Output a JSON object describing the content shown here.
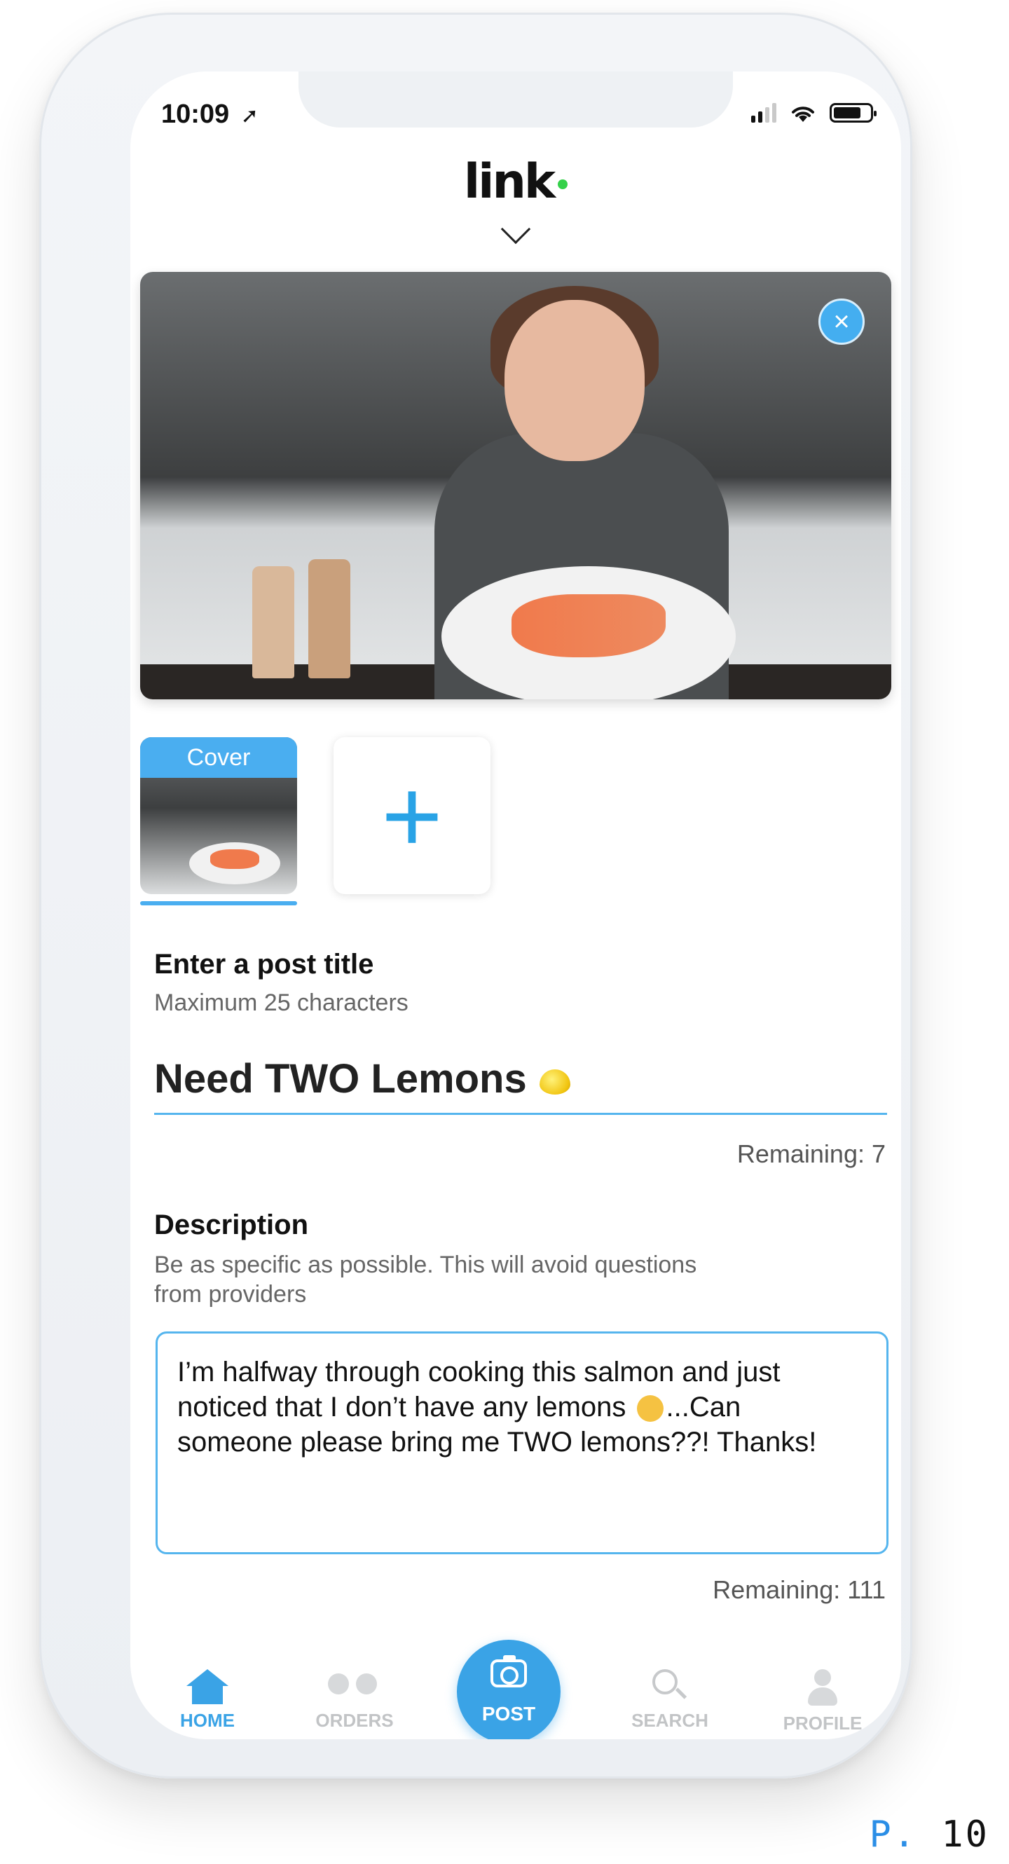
{
  "status_bar": {
    "time": "10:09"
  },
  "header": {
    "logo": "link"
  },
  "photos": {
    "cover_label": "Cover",
    "add_label": "+"
  },
  "title_section": {
    "label": "Enter a post title",
    "hint": "Maximum 25 characters",
    "value": "Need TWO Lemons",
    "remaining": "Remaining: 7"
  },
  "description_section": {
    "label": "Description",
    "hint_line1": "Be as specific as possible. This will avoid questions",
    "hint_line2": "from providers",
    "text_line1": "I’m halfway through cooking this salmon and just",
    "text_line2a": "noticed that I don’t have any lemons",
    "text_line2b": "...Can",
    "text_line3": "someone please bring me TWO lemons??! Thanks!",
    "remaining": "Remaining: 111"
  },
  "tabbar": {
    "home": "HOME",
    "orders": "ORDERS",
    "post": "POST",
    "search": "SEARCH",
    "profile": "PROFILE",
    "active": "home"
  },
  "colors": {
    "accent": "#3aa3e6",
    "logo_dot": "#35d14a"
  },
  "page_label": {
    "prefix": "P.",
    "number": "10"
  }
}
